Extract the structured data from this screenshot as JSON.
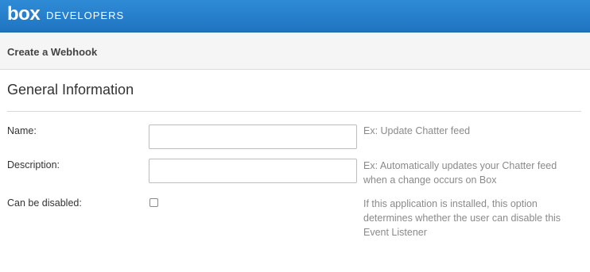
{
  "header": {
    "logo_text": "box",
    "brand_label": "DEVELOPERS"
  },
  "page": {
    "title": "Create a Webhook"
  },
  "section": {
    "title": "General Information"
  },
  "form": {
    "name": {
      "label": "Name:",
      "value": "",
      "help": "Ex: Update Chatter feed"
    },
    "description": {
      "label": "Description:",
      "value": "",
      "help": "Ex: Automatically updates your Chatter feed when a change occurs on Box"
    },
    "can_be_disabled": {
      "label": "Can be disabled:",
      "checked": false,
      "help": "If this application is installed, this option determines whether the user can disable this Event Listener"
    }
  },
  "colors": {
    "header_blue": "#1f74c0",
    "help_text": "#8a8a8a"
  }
}
